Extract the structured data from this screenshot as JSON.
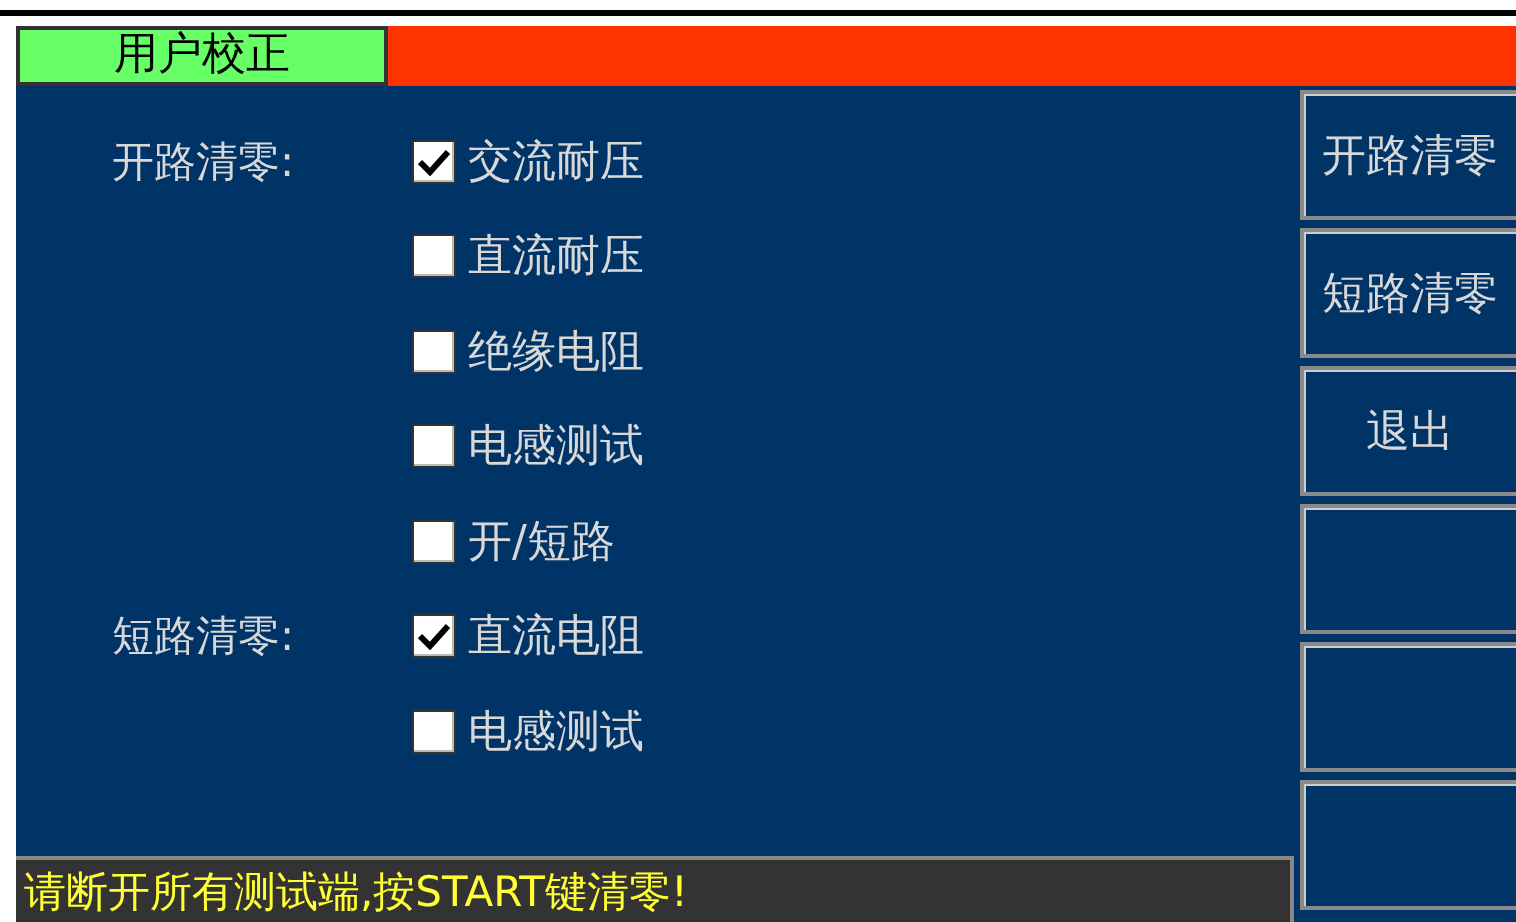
{
  "header": {
    "title": "用户校正"
  },
  "groups": [
    {
      "label": "开路清零:",
      "items": [
        {
          "label": "交流耐压",
          "checked": true
        },
        {
          "label": "直流耐压",
          "checked": false
        },
        {
          "label": "绝缘电阻",
          "checked": false
        },
        {
          "label": "电感测试",
          "checked": false
        },
        {
          "label": "开/短路",
          "checked": false
        }
      ]
    },
    {
      "label": "短路清零:",
      "items": [
        {
          "label": "直流电阻",
          "checked": true
        },
        {
          "label": "电感测试",
          "checked": false
        }
      ]
    }
  ],
  "side_buttons": [
    {
      "kind": "text",
      "label": "开路清零"
    },
    {
      "kind": "text",
      "label": "短路清零"
    },
    {
      "kind": "text",
      "label": "退出"
    },
    {
      "kind": "blank"
    },
    {
      "kind": "blank"
    },
    {
      "kind": "blank"
    }
  ],
  "status_bar": {
    "message": "请断开所有测试端,按START键清零!"
  }
}
